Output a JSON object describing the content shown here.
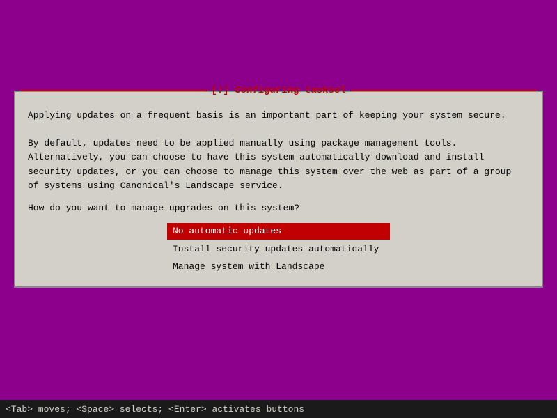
{
  "dialog": {
    "title": "[!] Configuring tasksel",
    "description_line1": "Applying updates on a frequent basis is an important part of keeping your system secure.",
    "description_line2": "By default, updates need to be applied manually using package management tools.\nAlternatively, you can choose to have this system automatically download and install\nsecurity updates, or you can choose to manage this system over the web as part of a group\nof systems using Canonical's Landscape service.",
    "question": "How do you want to manage upgrades on this system?",
    "options": [
      {
        "label": "No automatic updates",
        "selected": true
      },
      {
        "label": "Install security updates automatically",
        "selected": false
      },
      {
        "label": "Manage system with Landscape",
        "selected": false
      }
    ]
  },
  "status_bar": {
    "text": "<Tab> moves; <Space> selects; <Enter> activates buttons"
  },
  "colors": {
    "bg": "#8B008B",
    "dialog_bg": "#d3d0c8",
    "title_color": "#c00000",
    "selected_bg": "#c00000",
    "selected_text": "#ffffff",
    "status_bg": "#1a1a1a",
    "status_text": "#d3d0c8"
  }
}
